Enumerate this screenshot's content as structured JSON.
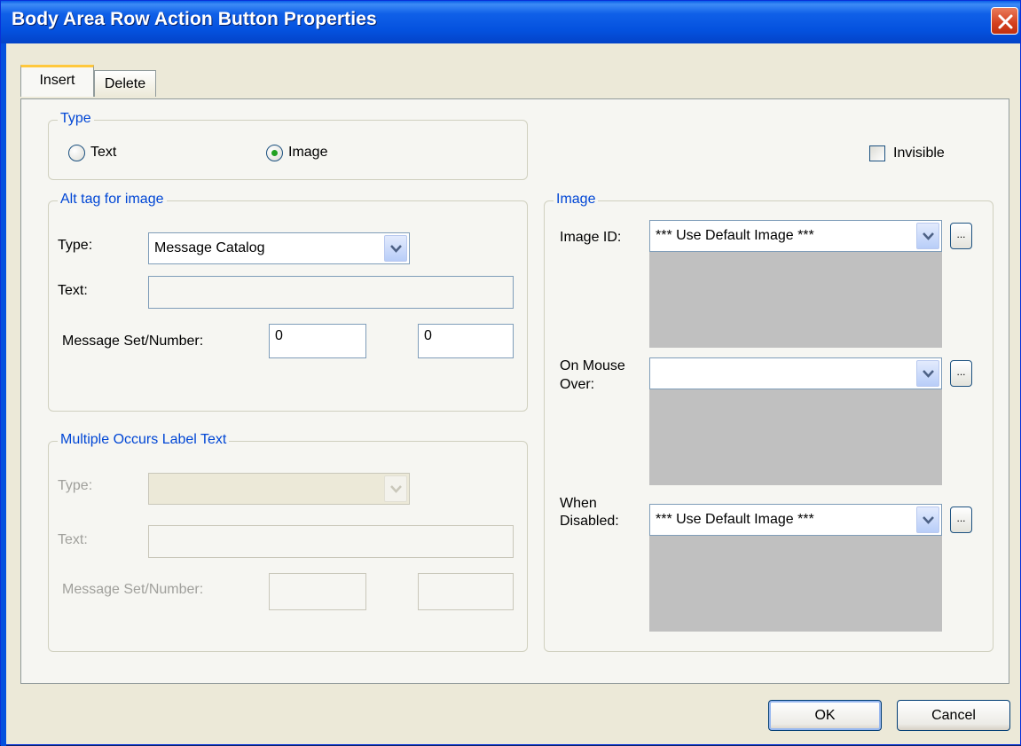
{
  "window": {
    "title": "Body Area Row Action Button Properties"
  },
  "tabs": [
    {
      "label": "Insert"
    },
    {
      "label": "Delete"
    }
  ],
  "type_group": {
    "legend": "Type",
    "options": [
      {
        "label": "Text",
        "selected": false
      },
      {
        "label": "Image",
        "selected": true
      }
    ],
    "invisible_label": "Invisible",
    "invisible_checked": false
  },
  "alt_tag": {
    "legend": "Alt tag for image",
    "type_label": "Type:",
    "type_value": "Message Catalog",
    "text_label": "Text:",
    "text_value": "",
    "msg_label": "Message Set/Number:",
    "msg_set": "0",
    "msg_number": "0"
  },
  "multi_occurs": {
    "legend": "Multiple Occurs Label Text",
    "type_label": "Type:",
    "type_value": "",
    "text_label": "Text:",
    "text_value": "",
    "msg_label": "Message Set/Number:",
    "msg_set": "",
    "msg_number": ""
  },
  "image_group": {
    "legend": "Image",
    "image_id_label": "Image ID:",
    "image_id_value": "*** Use Default Image ***",
    "mouse_over_label_1": "On Mouse",
    "mouse_over_label_2": "Over:",
    "mouse_over_value": "",
    "disabled_label_1": "When",
    "disabled_label_2": "Disabled:",
    "disabled_value": "*** Use Default Image ***",
    "browse_label": "..."
  },
  "buttons": {
    "ok": "OK",
    "cancel": "Cancel"
  },
  "colors": {
    "titlebar": "#0451de",
    "legend": "#0046d5",
    "dialog_bg": "#ece9d8",
    "preview": "#c0c0c0"
  },
  "icons": {
    "close": "close-icon",
    "dropdown": "chevron-down-icon"
  }
}
